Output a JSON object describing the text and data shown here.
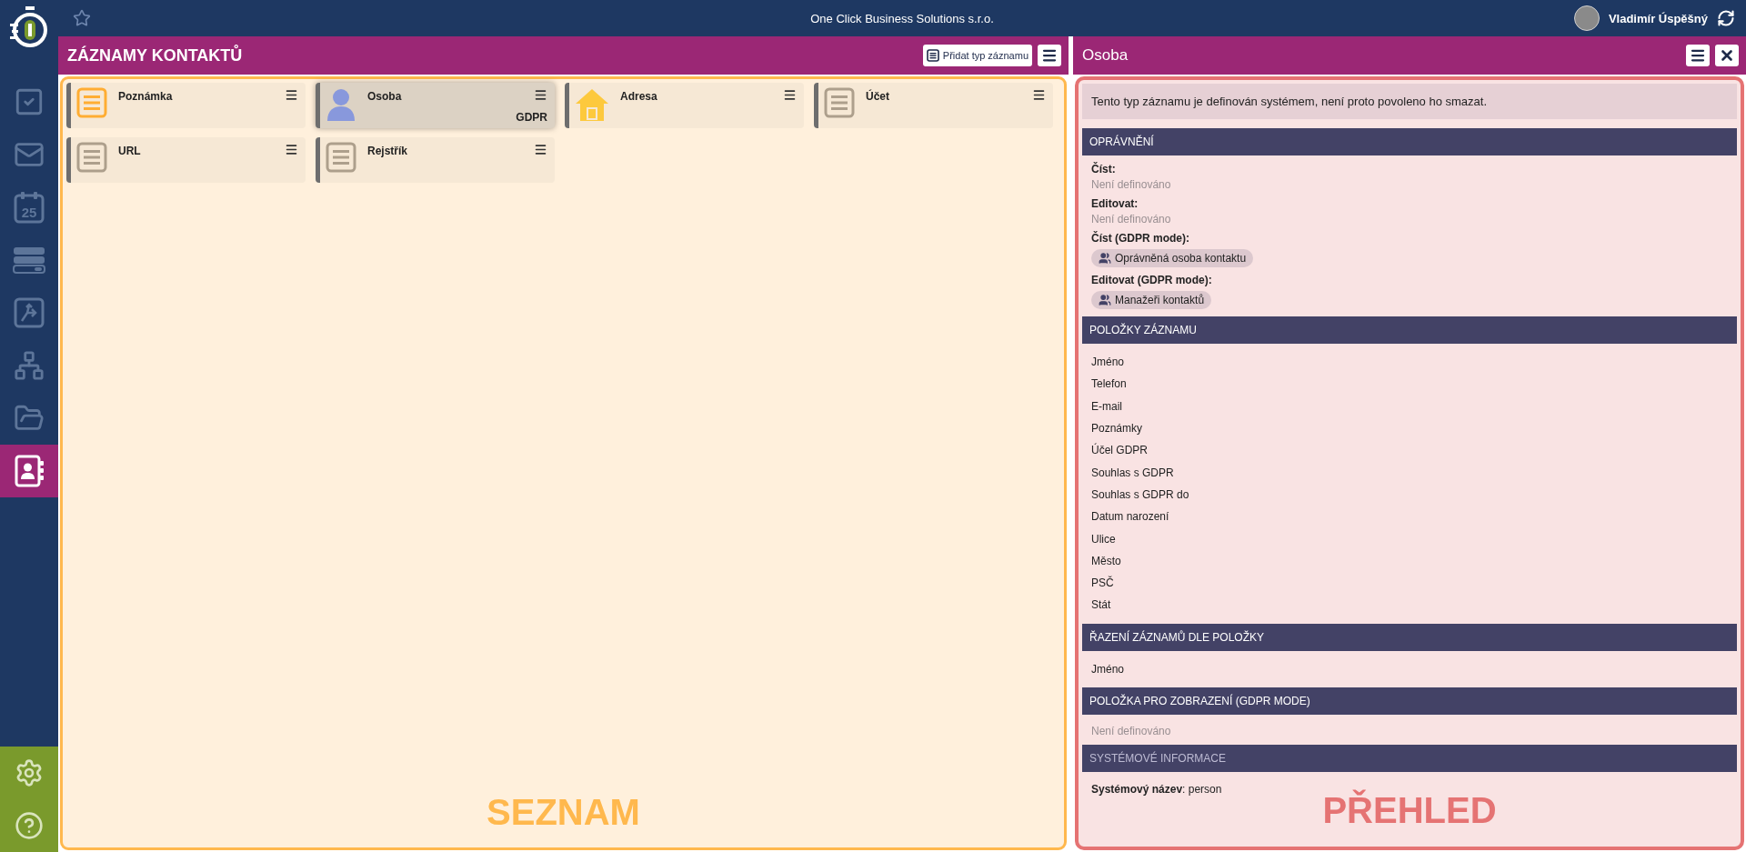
{
  "top_bar": {
    "title": "One Click Business Solutions s.r.o.",
    "user_name": "Vladimír Úspěšný"
  },
  "sidebar": {
    "items": [
      {
        "kind": "tasks",
        "selected": false
      },
      {
        "kind": "mail",
        "selected": false
      },
      {
        "kind": "calendar",
        "day": "25",
        "selected": false
      },
      {
        "kind": "list",
        "selected": false
      },
      {
        "kind": "workflow",
        "selected": false
      },
      {
        "kind": "org",
        "selected": false
      },
      {
        "kind": "folder",
        "selected": false
      },
      {
        "kind": "contacts",
        "selected": true
      }
    ],
    "footer_items": [
      {
        "kind": "settings"
      },
      {
        "kind": "help"
      }
    ]
  },
  "list_panel": {
    "title": "ZÁZNAMY KONTAKTŮ",
    "add_button": "Přidat typ záznamu",
    "cards": [
      {
        "label": "Poznámka",
        "kind": "note",
        "color": "#ffad33",
        "selected": false
      },
      {
        "label": "Osoba",
        "kind": "person",
        "selected": true,
        "badge": "GDPR"
      },
      {
        "label": "Adresa",
        "kind": "house",
        "selected": false
      },
      {
        "label": "Účet",
        "kind": "note",
        "color": "#ad9f8c",
        "selected": false
      },
      {
        "label": "URL",
        "kind": "note",
        "color": "#ad9f8c",
        "selected": false
      },
      {
        "label": "Rejstřík",
        "kind": "note",
        "color": "#ad9f8c",
        "selected": false
      }
    ],
    "caption": "SEZNAM"
  },
  "detail_panel": {
    "title": "Osoba",
    "notice": "Tento typ záznamu je definován systémem, není proto povoleno ho smazat.",
    "sections": [
      {
        "title": "OPRÁVNĚNÍ",
        "kind": "permissions",
        "entries": [
          {
            "label": "Číst:",
            "value": "Není definováno"
          },
          {
            "label": "Editovat:",
            "value": "Není definováno"
          },
          {
            "label": "Číst (GDPR mode):",
            "chips": [
              "Oprávněná osoba kontaktu"
            ]
          },
          {
            "label": "Editovat (GDPR mode):",
            "chips": [
              "Manažeři kontaktů"
            ]
          }
        ]
      },
      {
        "title": "POLOŽKY ZÁZNAMU",
        "kind": "list",
        "items": [
          "Jméno",
          "Telefon",
          "E-mail",
          "Poznámky",
          "Účel GDPR",
          "Souhlas s GDPR",
          "Souhlas s GDPR do",
          "Datum narození",
          "Ulice",
          "Město",
          "PSČ",
          "Stát"
        ]
      },
      {
        "title": "ŘAZENÍ ZÁZNAMŮ DLE POLOŽKY",
        "kind": "list",
        "items": [
          "Jméno"
        ]
      },
      {
        "title": "POLOŽKA PRO ZOBRAZENÍ (GDPR MODE)",
        "kind": "empty",
        "text": "Není definováno"
      },
      {
        "title": "SYSTÉMOVÉ INFORMACE",
        "kind": "properties",
        "properties": [
          "**Systémový název**: person"
        ]
      }
    ],
    "caption": "PŘEHLED"
  }
}
